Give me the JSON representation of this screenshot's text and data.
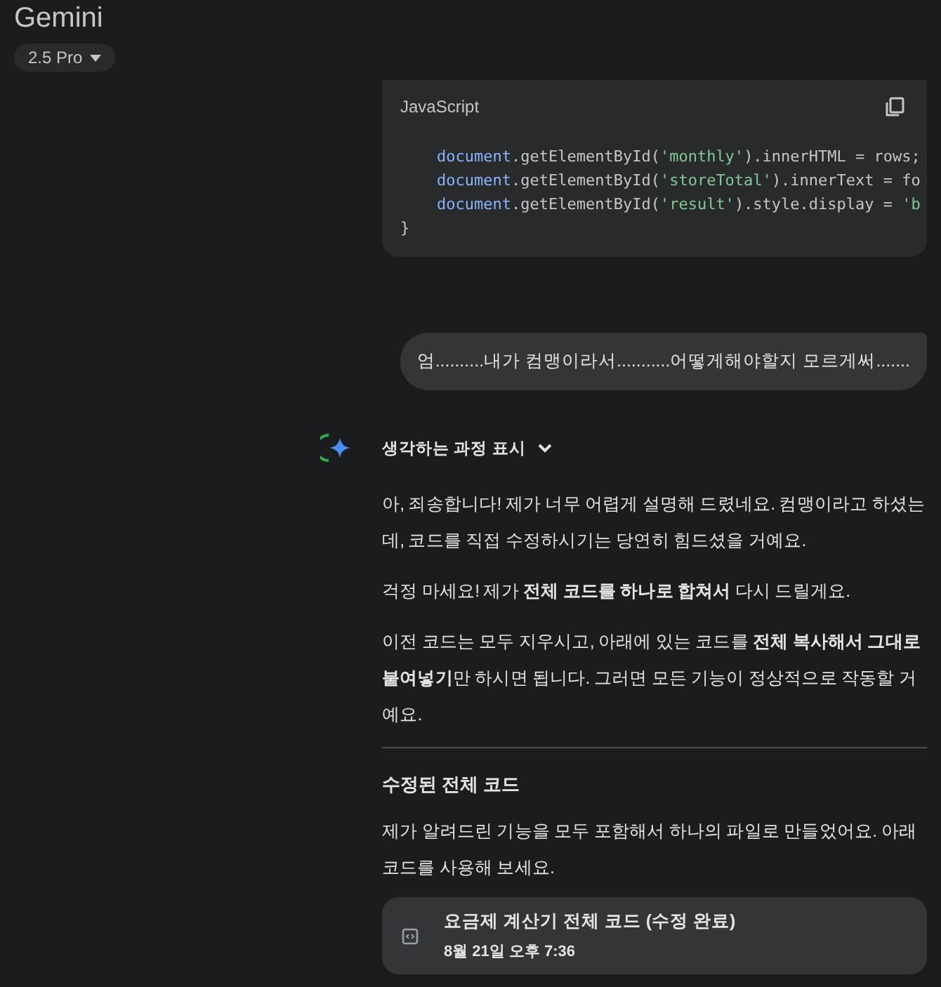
{
  "header": {
    "title": "Gemini",
    "model_picker": "2.5 Pro"
  },
  "code_block": {
    "language": "JavaScript",
    "lines": [
      {
        "indented": true,
        "tokens": [
          {
            "kind": "keyword",
            "text": "document"
          },
          {
            "kind": "plain",
            "text": ".getElementById("
          },
          {
            "kind": "string",
            "text": "'monthly'"
          },
          {
            "kind": "plain",
            "text": ").innerHTML = rows;"
          }
        ]
      },
      {
        "indented": true,
        "tokens": [
          {
            "kind": "keyword",
            "text": "document"
          },
          {
            "kind": "plain",
            "text": ".getElementById("
          },
          {
            "kind": "string",
            "text": "'storeTotal'"
          },
          {
            "kind": "plain",
            "text": ").innerText = fo"
          }
        ]
      },
      {
        "indented": true,
        "tokens": [
          {
            "kind": "keyword",
            "text": "document"
          },
          {
            "kind": "plain",
            "text": ".getElementById("
          },
          {
            "kind": "string",
            "text": "'result'"
          },
          {
            "kind": "plain",
            "text": ").style.display = "
          },
          {
            "kind": "string",
            "text": "'b"
          }
        ]
      },
      {
        "indented": false,
        "tokens": [
          {
            "kind": "plain",
            "text": "}"
          }
        ]
      }
    ]
  },
  "user_message": "엄..........내가 컴맹이라서...........어떻게해야할지 모르게써.......",
  "thinking_toggle": {
    "label": "생각하는 과정 표시",
    "expanded": false
  },
  "response": [
    {
      "kind": "paragraph",
      "text": "아, 죄송합니다! 제가 너무 어렵게 설명해 드렸네요. 컴맹이라고 하셨는데, 코드를 직접 수정하시기는 당연히 힘드셨을 거예요."
    },
    {
      "kind": "paragraph",
      "text": "걱정 마세요! 제가 **전체 코드를 하나로 합쳐서** 다시 드릴게요."
    },
    {
      "kind": "paragraph",
      "text": "이전 코드는 모두 지우시고, 아래에 있는 코드를 **전체 복사해서 그대로 붙여넣기**만 하시면 됩니다. 그러면 모든 기능이 정상적으로 작동할 거예요."
    },
    {
      "kind": "divider"
    },
    {
      "kind": "heading",
      "text": "수정된 전체 코드"
    },
    {
      "kind": "paragraph",
      "text": "제가 알려드린 기능을 모두 포함해서 하나의 파일로 만들었어요. 아래 코드를 사용해 보세요."
    },
    {
      "kind": "file_card",
      "title": "요금제 계산기 전체 코드 (수정 완료)",
      "date": "8월 21일 오후 7:36"
    }
  ]
}
